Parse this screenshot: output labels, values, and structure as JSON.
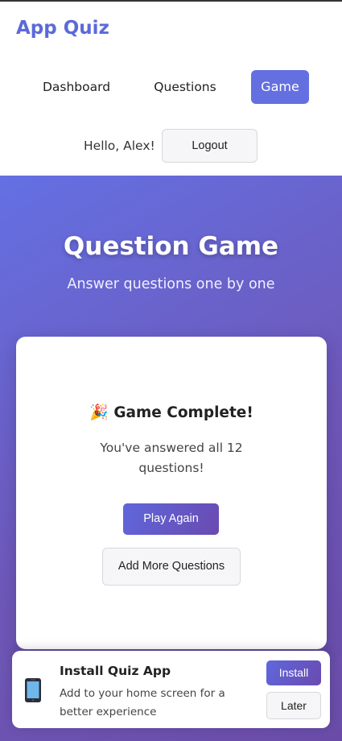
{
  "header": {
    "brand": "App Quiz",
    "nav": [
      {
        "label": "Dashboard",
        "active": false
      },
      {
        "label": "Questions",
        "active": false
      },
      {
        "label": "Game",
        "active": true
      }
    ],
    "greeting": "Hello, Alex!",
    "logout_label": "Logout"
  },
  "hero": {
    "title": "Question Game",
    "subtitle": "Answer questions one by one"
  },
  "game_card": {
    "emoji": "🎉",
    "title": "Game Complete!",
    "message": "You've answered all 12 questions!",
    "play_again_label": "Play Again",
    "add_questions_label": "Add More Questions"
  },
  "install_banner": {
    "icon": "mobile-phone-icon",
    "title": "Install Quiz App",
    "description": "Add to your home screen for a better experience",
    "install_label": "Install",
    "later_label": "Later"
  },
  "colors": {
    "accent": "#6470e0",
    "gradient_start": "#6470e3",
    "gradient_end": "#6a4ca8"
  }
}
